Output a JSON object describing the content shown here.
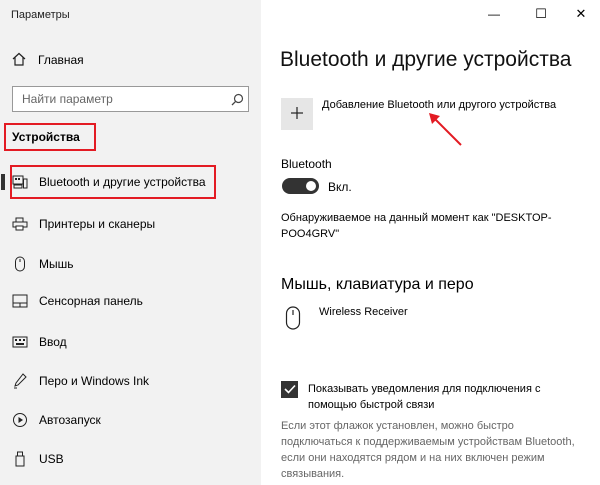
{
  "window": {
    "title": "Параметры",
    "controls": {
      "minimize": "—",
      "maximize": "☐",
      "close": "✕"
    }
  },
  "sidebar": {
    "home_label": "Главная",
    "search_placeholder": "Найти параметр",
    "section_title": "Устройства",
    "items": [
      {
        "label": "Bluetooth и другие устройства",
        "icon": "bluetooth-devices-icon",
        "selected": true
      },
      {
        "label": "Принтеры и сканеры",
        "icon": "printer-icon"
      },
      {
        "label": "Мышь",
        "icon": "mouse-icon"
      },
      {
        "label": "Сенсорная панель",
        "icon": "touchpad-icon"
      },
      {
        "label": "Ввод",
        "icon": "keyboard-icon"
      },
      {
        "label": "Перо и Windows Ink",
        "icon": "pen-icon"
      },
      {
        "label": "Автозапуск",
        "icon": "autoplay-icon"
      },
      {
        "label": "USB",
        "icon": "usb-icon"
      }
    ]
  },
  "main": {
    "title": "Bluetooth и другие устройства",
    "add_device_label": "Добавление Bluetooth или другого устройства",
    "add_symbol": "+",
    "bluetooth_label": "Bluetooth",
    "toggle_state": "Вкл.",
    "discoverable_text": "Обнаруживаемое на данный момент как \"DESKTOP-POO4GRV\"",
    "input_section_title": "Мышь, клавиатура и перо",
    "device_name": "Wireless Receiver",
    "swift_pair_label": "Показывать уведомления для подключения с помощью быстрой связи",
    "swift_pair_hint": "Если этот флажок установлен, можно быстро подключаться к поддерживаемым устройствам Bluetooth, если они находятся рядом и на них включен режим связывания."
  },
  "colors": {
    "accent_highlight": "#e31b23",
    "sidebar_bg": "#f2f2f2",
    "toggle_on": "#333333"
  }
}
